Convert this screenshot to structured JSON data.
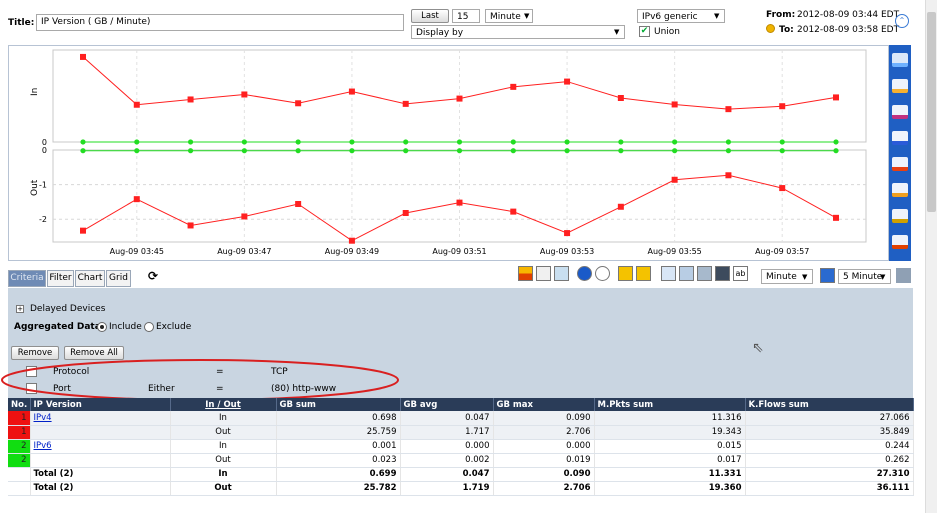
{
  "header": {
    "title_label": "Title:",
    "title_value": "IP Version ( GB / Minute)",
    "last_button": "Last",
    "last_count": "15",
    "unit_select": "Minute",
    "display_by": "Display by",
    "ipv6_select": "IPv6 generic",
    "union_label": "Union",
    "from_label": "From:",
    "from_value": "2012-08-09 03:44 EDT",
    "to_label": "To:",
    "to_value": "2012-08-09 03:58 EDT"
  },
  "chart_data": {
    "type": "line",
    "x": [
      "Aug-09 03:44",
      "Aug-09 03:45",
      "Aug-09 03:46",
      "Aug-09 03:47",
      "Aug-09 03:48",
      "Aug-09 03:49",
      "Aug-09 03:50",
      "Aug-09 03:51",
      "Aug-09 03:52",
      "Aug-09 03:53",
      "Aug-09 03:54",
      "Aug-09 03:55",
      "Aug-09 03:56",
      "Aug-09 03:57",
      "Aug-09 03:58"
    ],
    "x_tick_labels": [
      "Aug-09 03:45",
      "Aug-09 03:47",
      "Aug-09 03:49",
      "Aug-09 03:51",
      "Aug-09 03:53",
      "Aug-09 03:55",
      "Aug-09 03:57"
    ],
    "in_panel": {
      "ylabel": "In",
      "yticks": [
        "0"
      ],
      "ylim": [
        0,
        3
      ],
      "series": [
        {
          "color": "#ff2020",
          "values": [
            2.9,
            1.27,
            1.45,
            1.62,
            1.32,
            1.72,
            1.3,
            1.48,
            1.88,
            2.06,
            1.5,
            1.28,
            1.12,
            1.22,
            1.52
          ]
        },
        {
          "color": "#22dd22",
          "values": [
            0.001,
            0.001,
            0.001,
            0.001,
            0.001,
            0.001,
            0.001,
            0.001,
            0.001,
            0.001,
            0.001,
            0.001,
            0.001,
            0.001,
            0.001
          ]
        }
      ]
    },
    "out_panel": {
      "ylabel": "Out",
      "yticks": [
        "0",
        "-1",
        "-2"
      ],
      "ylim": [
        -2.6,
        0
      ],
      "series": [
        {
          "color": "#ff2020",
          "values": [
            -2.33,
            -1.42,
            -2.18,
            -1.92,
            -1.56,
            -2.62,
            -1.82,
            -1.52,
            -1.78,
            -2.4,
            -1.64,
            -0.86,
            -0.73,
            -1.1,
            -1.96
          ]
        },
        {
          "color": "#22dd22",
          "values": [
            -0.02,
            -0.02,
            -0.02,
            -0.02,
            -0.02,
            -0.02,
            -0.02,
            -0.02,
            -0.02,
            -0.02,
            -0.02,
            -0.02,
            -0.02,
            -0.02,
            -0.02
          ]
        }
      ]
    }
  },
  "right_toolbar_icons": [
    "area-chart-icon",
    "line-chart-icon",
    "3d-area-icon",
    "bar-chart-icon",
    "3d-bar-icon",
    "stacked-bar-icon",
    "pie-chart-icon",
    "3d-pie-icon"
  ],
  "tabs": [
    {
      "label": "Criteria",
      "active": true
    },
    {
      "label": "Filter",
      "active": false
    },
    {
      "label": "Chart",
      "active": false
    },
    {
      "label": "Grid",
      "active": false
    }
  ],
  "toolbar": {
    "unit_select": "Minute",
    "interval_select": "5 Minute"
  },
  "criteria": {
    "delayed_devices": "Delayed Devices",
    "aggregated_label": "Aggregated Data",
    "include_label": "Include",
    "exclude_label": "Exclude",
    "remove_button": "Remove",
    "remove_all_button": "Remove All",
    "rows": [
      {
        "field": "Protocol",
        "direction": "",
        "op": "=",
        "value": "TCP"
      },
      {
        "field": "Port",
        "direction": "Either",
        "op": "=",
        "value": "(80) http-www"
      }
    ],
    "highlight_color": "#d92020"
  },
  "grid": {
    "columns": [
      "No.",
      "IP Version",
      "In / Out",
      "GB sum",
      "GB avg",
      "GB max",
      "M.Pkts sum",
      "K.Flows sum"
    ],
    "rows": [
      {
        "no": "1",
        "color": "#ee1111",
        "version": "IPv4",
        "dir": "In",
        "gb_sum": "0.698",
        "gb_avg": "0.047",
        "gb_max": "0.090",
        "pkts": "11.316",
        "flows": "27.066"
      },
      {
        "no": "1",
        "color": "#ee1111",
        "version": "",
        "dir": "Out",
        "gb_sum": "25.759",
        "gb_avg": "1.717",
        "gb_max": "2.706",
        "pkts": "19.343",
        "flows": "35.849"
      },
      {
        "no": "2",
        "color": "#11dd11",
        "version": "IPv6",
        "dir": "In",
        "gb_sum": "0.001",
        "gb_avg": "0.000",
        "gb_max": "0.000",
        "pkts": "0.015",
        "flows": "0.244"
      },
      {
        "no": "2",
        "color": "#11dd11",
        "version": "",
        "dir": "Out",
        "gb_sum": "0.023",
        "gb_avg": "0.002",
        "gb_max": "0.019",
        "pkts": "0.017",
        "flows": "0.262"
      }
    ],
    "totals": [
      {
        "label": "Total (2)",
        "dir": "In",
        "gb_sum": "0.699",
        "gb_avg": "0.047",
        "gb_max": "0.090",
        "pkts": "11.331",
        "flows": "27.310"
      },
      {
        "label": "Total (2)",
        "dir": "Out",
        "gb_sum": "25.782",
        "gb_avg": "1.719",
        "gb_max": "2.706",
        "pkts": "19.360",
        "flows": "36.111"
      }
    ]
  }
}
